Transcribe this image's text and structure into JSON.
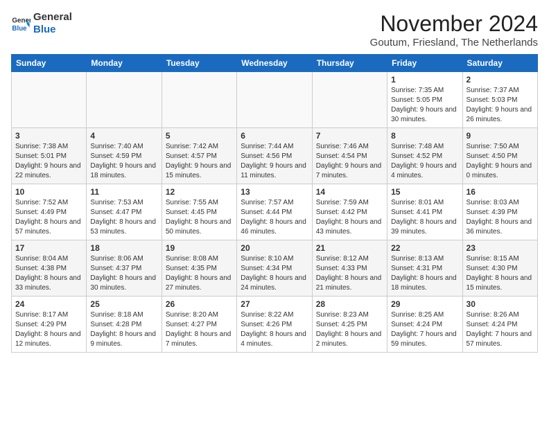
{
  "logo": {
    "line1": "General",
    "line2": "Blue"
  },
  "title": "November 2024",
  "location": "Goutum, Friesland, The Netherlands",
  "weekdays": [
    "Sunday",
    "Monday",
    "Tuesday",
    "Wednesday",
    "Thursday",
    "Friday",
    "Saturday"
  ],
  "weeks": [
    [
      {
        "day": "",
        "info": ""
      },
      {
        "day": "",
        "info": ""
      },
      {
        "day": "",
        "info": ""
      },
      {
        "day": "",
        "info": ""
      },
      {
        "day": "",
        "info": ""
      },
      {
        "day": "1",
        "info": "Sunrise: 7:35 AM\nSunset: 5:05 PM\nDaylight: 9 hours and 30 minutes."
      },
      {
        "day": "2",
        "info": "Sunrise: 7:37 AM\nSunset: 5:03 PM\nDaylight: 9 hours and 26 minutes."
      }
    ],
    [
      {
        "day": "3",
        "info": "Sunrise: 7:38 AM\nSunset: 5:01 PM\nDaylight: 9 hours and 22 minutes."
      },
      {
        "day": "4",
        "info": "Sunrise: 7:40 AM\nSunset: 4:59 PM\nDaylight: 9 hours and 18 minutes."
      },
      {
        "day": "5",
        "info": "Sunrise: 7:42 AM\nSunset: 4:57 PM\nDaylight: 9 hours and 15 minutes."
      },
      {
        "day": "6",
        "info": "Sunrise: 7:44 AM\nSunset: 4:56 PM\nDaylight: 9 hours and 11 minutes."
      },
      {
        "day": "7",
        "info": "Sunrise: 7:46 AM\nSunset: 4:54 PM\nDaylight: 9 hours and 7 minutes."
      },
      {
        "day": "8",
        "info": "Sunrise: 7:48 AM\nSunset: 4:52 PM\nDaylight: 9 hours and 4 minutes."
      },
      {
        "day": "9",
        "info": "Sunrise: 7:50 AM\nSunset: 4:50 PM\nDaylight: 9 hours and 0 minutes."
      }
    ],
    [
      {
        "day": "10",
        "info": "Sunrise: 7:52 AM\nSunset: 4:49 PM\nDaylight: 8 hours and 57 minutes."
      },
      {
        "day": "11",
        "info": "Sunrise: 7:53 AM\nSunset: 4:47 PM\nDaylight: 8 hours and 53 minutes."
      },
      {
        "day": "12",
        "info": "Sunrise: 7:55 AM\nSunset: 4:45 PM\nDaylight: 8 hours and 50 minutes."
      },
      {
        "day": "13",
        "info": "Sunrise: 7:57 AM\nSunset: 4:44 PM\nDaylight: 8 hours and 46 minutes."
      },
      {
        "day": "14",
        "info": "Sunrise: 7:59 AM\nSunset: 4:42 PM\nDaylight: 8 hours and 43 minutes."
      },
      {
        "day": "15",
        "info": "Sunrise: 8:01 AM\nSunset: 4:41 PM\nDaylight: 8 hours and 39 minutes."
      },
      {
        "day": "16",
        "info": "Sunrise: 8:03 AM\nSunset: 4:39 PM\nDaylight: 8 hours and 36 minutes."
      }
    ],
    [
      {
        "day": "17",
        "info": "Sunrise: 8:04 AM\nSunset: 4:38 PM\nDaylight: 8 hours and 33 minutes."
      },
      {
        "day": "18",
        "info": "Sunrise: 8:06 AM\nSunset: 4:37 PM\nDaylight: 8 hours and 30 minutes."
      },
      {
        "day": "19",
        "info": "Sunrise: 8:08 AM\nSunset: 4:35 PM\nDaylight: 8 hours and 27 minutes."
      },
      {
        "day": "20",
        "info": "Sunrise: 8:10 AM\nSunset: 4:34 PM\nDaylight: 8 hours and 24 minutes."
      },
      {
        "day": "21",
        "info": "Sunrise: 8:12 AM\nSunset: 4:33 PM\nDaylight: 8 hours and 21 minutes."
      },
      {
        "day": "22",
        "info": "Sunrise: 8:13 AM\nSunset: 4:31 PM\nDaylight: 8 hours and 18 minutes."
      },
      {
        "day": "23",
        "info": "Sunrise: 8:15 AM\nSunset: 4:30 PM\nDaylight: 8 hours and 15 minutes."
      }
    ],
    [
      {
        "day": "24",
        "info": "Sunrise: 8:17 AM\nSunset: 4:29 PM\nDaylight: 8 hours and 12 minutes."
      },
      {
        "day": "25",
        "info": "Sunrise: 8:18 AM\nSunset: 4:28 PM\nDaylight: 8 hours and 9 minutes."
      },
      {
        "day": "26",
        "info": "Sunrise: 8:20 AM\nSunset: 4:27 PM\nDaylight: 8 hours and 7 minutes."
      },
      {
        "day": "27",
        "info": "Sunrise: 8:22 AM\nSunset: 4:26 PM\nDaylight: 8 hours and 4 minutes."
      },
      {
        "day": "28",
        "info": "Sunrise: 8:23 AM\nSunset: 4:25 PM\nDaylight: 8 hours and 2 minutes."
      },
      {
        "day": "29",
        "info": "Sunrise: 8:25 AM\nSunset: 4:24 PM\nDaylight: 7 hours and 59 minutes."
      },
      {
        "day": "30",
        "info": "Sunrise: 8:26 AM\nSunset: 4:24 PM\nDaylight: 7 hours and 57 minutes."
      }
    ]
  ]
}
